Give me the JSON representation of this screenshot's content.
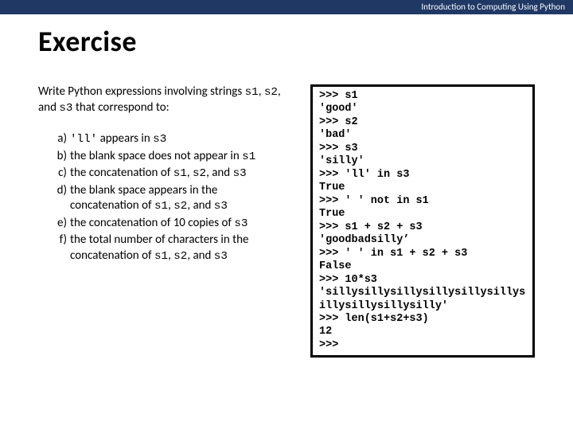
{
  "header": {
    "course": "Introduction to Computing Using Python"
  },
  "title": "Exercise",
  "intro": {
    "pre": "Write Python expressions involving strings ",
    "s1": "s1",
    "c1": ", ",
    "s2": "s2",
    "c2": ", and ",
    "s3": "s3",
    "post": " that correspond to:"
  },
  "items": {
    "a": {
      "m": "a)",
      "pre": "",
      "code": "'ll'",
      "mid": " appears in ",
      "code2": "s3",
      "post": ""
    },
    "b": {
      "m": "b)",
      "pre": "the blank space does not appear in ",
      "code": "s1",
      "post": ""
    },
    "c": {
      "m": "c)",
      "pre": "the concatenation of ",
      "c1": "s1",
      "s1": ", ",
      "c2": "s2",
      "s2": ", and ",
      "c3": "s3",
      "post": ""
    },
    "d": {
      "m": "d)",
      "pre": "the blank space appears in the concatenation of ",
      "c1": "s1",
      "s1": ", ",
      "c2": "s2",
      "s2": ", and ",
      "c3": "s3",
      "post": ""
    },
    "e": {
      "m": "e)",
      "pre": "the concatenation of 10 copies of ",
      "code": "s3",
      "post": ""
    },
    "f": {
      "m": "f)",
      "pre": "the total number of characters in the concatenation of ",
      "c1": "s1",
      "s1": ", ",
      "c2": "s2",
      "s2": ", and ",
      "c3": "s3",
      "post": ""
    }
  },
  "terminal": ">>> s1\n'good'\n>>> s2\n'bad'\n>>> s3\n'silly'\n>>> 'll' in s3\nTrue\n>>> ' ' not in s1\nTrue\n>>> s1 + s2 + s3\n'goodbadsilly’\n>>> ' ' in s1 + s2 + s3\nFalse\n>>> 10*s3\n'sillysillysillysillysillysillysillysillysillysilly'\n>>> len(s1+s2+s3)\n12\n>>>"
}
